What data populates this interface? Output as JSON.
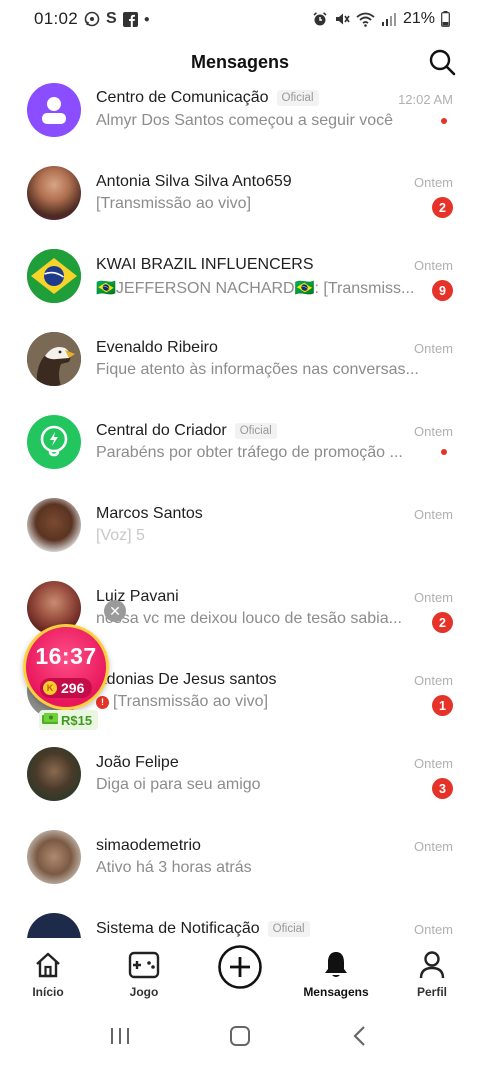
{
  "status_bar": {
    "time": "01:02",
    "battery": "21%"
  },
  "header": {
    "title": "Mensagens",
    "search_icon": "search-icon"
  },
  "conversations": [
    {
      "name": "Centro de Comunicação",
      "official": "Oficial",
      "preview": "Almyr Dos Santos começou a seguir você",
      "time": "12:02 AM",
      "badge": "",
      "dot": true,
      "avatar": "person-icon",
      "avatar_color": "#8a4dff"
    },
    {
      "name": "Antonia Silva Silva Anto659",
      "official": "",
      "preview": "[Transmissão ao vivo]",
      "time": "Ontem",
      "badge": "2",
      "dot": false,
      "avatar": "photo",
      "avatar_color": "#7a4a3a"
    },
    {
      "name": "KWAI BRAZIL INFLUENCERS",
      "official": "",
      "preview": "🇧🇷JEFFERSON NACHARD🇧🇷: [Transmiss...",
      "time": "Ontem",
      "badge": "9",
      "dot": false,
      "avatar": "brazil-flag",
      "avatar_color": "#1f9e3a"
    },
    {
      "name": "Evenaldo Ribeiro",
      "official": "",
      "preview": "Fique atento às informações nas conversas...",
      "time": "Ontem",
      "badge": "",
      "dot": false,
      "avatar": "eagle-photo",
      "avatar_color": "#4a4038"
    },
    {
      "name": "Central do Criador",
      "official": "Oficial",
      "preview": "Parabéns por obter tráfego de promoção ...",
      "time": "Ontem",
      "badge": "",
      "dot": true,
      "avatar": "lightbulb-icon",
      "avatar_color": "#22c55e"
    },
    {
      "name": "Marcos Santos",
      "official": "",
      "preview": "[Voz] 5",
      "time": "Ontem",
      "badge": "",
      "dot": false,
      "avatar": "photo",
      "avatar_color": "#5a3a28"
    },
    {
      "name": "Luiz Pavani",
      "official": "",
      "preview": "nossa vc me deixou louco de tesão sabia...",
      "time": "Ontem",
      "badge": "2",
      "dot": false,
      "avatar": "photo",
      "avatar_color": "#8a3a2e"
    },
    {
      "name": "Adonias De Jesus santos",
      "official": "",
      "preview": "[Transmissão ao vivo]",
      "time": "Ontem",
      "badge": "1",
      "dot": false,
      "avatar": "photo",
      "avatar_color": "#6a6a6a"
    },
    {
      "name": "João Felipe",
      "official": "",
      "preview": "Diga oi para seu amigo",
      "time": "Ontem",
      "badge": "3",
      "dot": false,
      "avatar": "photo",
      "avatar_color": "#3a4a38"
    },
    {
      "name": "simaodemetrio",
      "official": "",
      "preview": "Ativo há 3 horas atrás",
      "time": "Ontem",
      "badge": "",
      "dot": false,
      "avatar": "photo",
      "avatar_color": "#6a5040"
    },
    {
      "name": "Sistema de Notificação",
      "official": "Oficial",
      "preview": "",
      "time": "Ontem",
      "badge": "",
      "dot": false,
      "avatar": "bell-icon",
      "avatar_color": "#1e2a4a"
    }
  ],
  "floating_widget": {
    "timer": "16:37",
    "coins": "296",
    "reward": "R$15"
  },
  "bottom_nav": [
    {
      "label": "Início",
      "icon": "home-icon"
    },
    {
      "label": "Jogo",
      "icon": "gamepad-icon"
    },
    {
      "label": "",
      "icon": "plus-circle-icon"
    },
    {
      "label": "Mensagens",
      "icon": "bell-icon"
    },
    {
      "label": "Perfil",
      "icon": "profile-icon"
    }
  ]
}
